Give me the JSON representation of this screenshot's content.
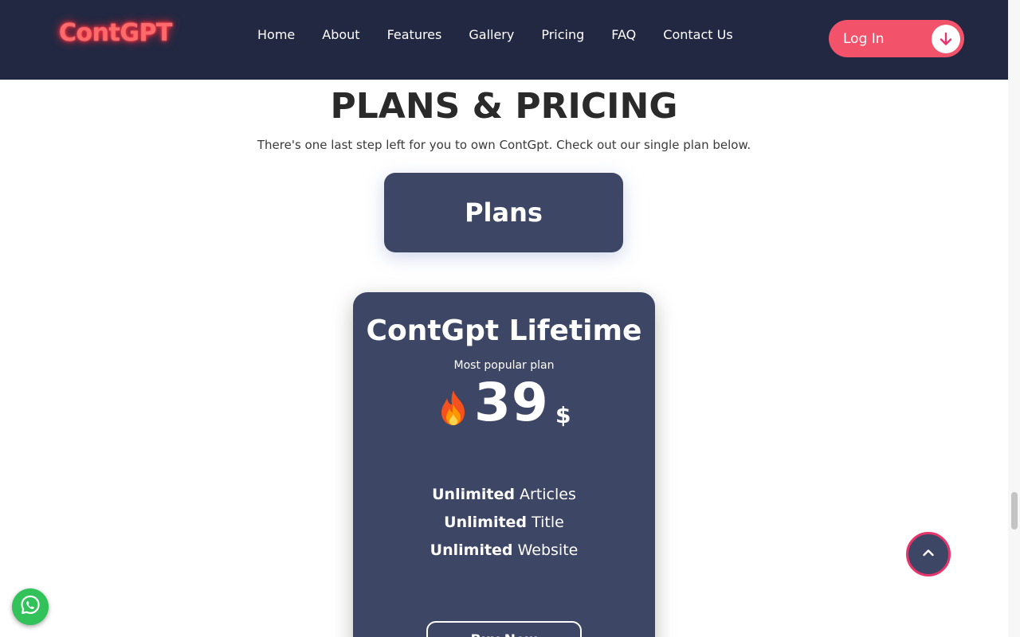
{
  "header": {
    "logo": "ContGPT",
    "nav": [
      "Home",
      "About",
      "Features",
      "Gallery",
      "Pricing",
      "FAQ",
      "Contact Us"
    ],
    "login_label": "Log In",
    "login_icon": "arrow-down-icon"
  },
  "pricing": {
    "title": "PLANS & PRICING",
    "subtitle": "There's one last step left for you to own ContGpt. Check out our single plan below.",
    "tab_label": "Plans",
    "plan": {
      "name": "ContGpt Lifetime",
      "tagline": "Most popular plan",
      "price": "39",
      "currency": "$",
      "features": [
        {
          "strong": "Unlimited",
          "text": " Articles"
        },
        {
          "strong": "Unlimited",
          "text": " Title"
        },
        {
          "strong": "Unlimited",
          "text": " Website"
        }
      ],
      "button_label": "Buy Now"
    }
  },
  "floating": {
    "whatsapp_icon": "whatsapp-icon",
    "scroll_top_icon": "chevron-up-icon"
  },
  "colors": {
    "header_bg": "#222842",
    "card_bg": "#3d4664",
    "accent": "#f2526a",
    "logo": "#ff6a6a",
    "whatsapp": "#32c25a"
  }
}
